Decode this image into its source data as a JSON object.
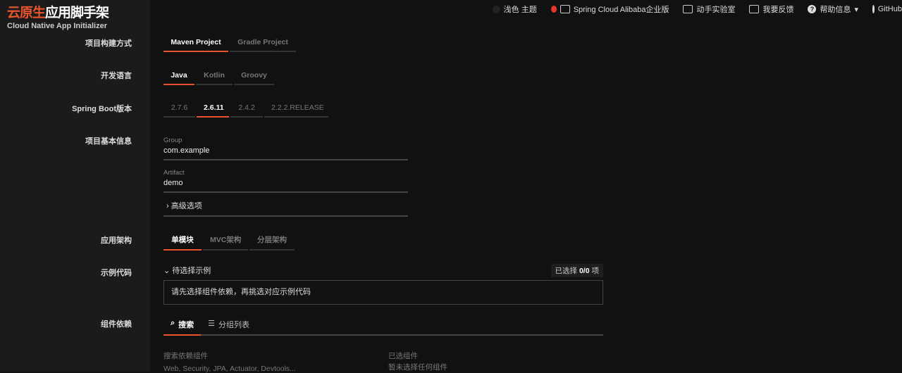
{
  "brand": {
    "accent": "云原生",
    "rest": "应用脚手架",
    "subtitle": "Cloud Native App Initializer"
  },
  "topnav": {
    "theme": "浅色 主题",
    "alibaba": "Spring Cloud Alibaba企业版",
    "lab": "动手实验室",
    "feedback": "我要反馈",
    "help": "帮助信息",
    "github": "GitHub"
  },
  "form": {
    "build": {
      "label": "项目构建方式",
      "options": [
        "Maven Project",
        "Gradle Project"
      ],
      "selected": "Maven Project"
    },
    "language": {
      "label": "开发语言",
      "options": [
        "Java",
        "Kotlin",
        "Groovy"
      ],
      "selected": "Java"
    },
    "boot": {
      "label": "Spring Boot版本",
      "options": [
        "2.7.6",
        "2.6.11",
        "2.4.2",
        "2.2.2.RELEASE"
      ],
      "selected": "2.6.11"
    },
    "info": {
      "label": "项目基本信息",
      "group_label": "Group",
      "group": "com.example",
      "artifact_label": "Artifact",
      "artifact": "demo",
      "advanced": "高级选项"
    },
    "arch": {
      "label": "应用架构",
      "options": [
        "单模块",
        "MVC架构",
        "分层架构"
      ],
      "selected": "单模块"
    },
    "example": {
      "label": "示例代码",
      "header": "待选择示例",
      "count_prefix": "已选择",
      "count": "0/0",
      "count_suffix": "项",
      "hint": "请先选择组件依赖，再挑选对应示例代码"
    },
    "deps": {
      "label": "组件依赖",
      "tabs": [
        "搜索",
        "分组列表"
      ],
      "search_label": "搜索依赖组件",
      "search_placeholder": "Web, Security, JPA, Actuator, Devtools...",
      "selected_label": "已选组件",
      "none": "暂未选择任何组件"
    }
  },
  "colors": {
    "accent": "#e8542b"
  }
}
